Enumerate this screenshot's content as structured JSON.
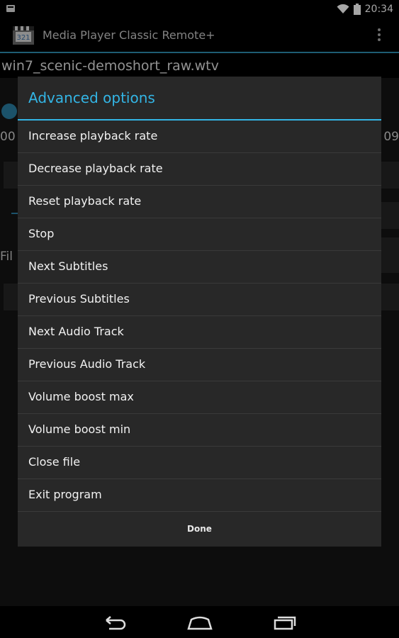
{
  "status_bar": {
    "time": "20:34"
  },
  "action_bar": {
    "title": "Media Player Classic Remote+",
    "icon_text": "321"
  },
  "background": {
    "filename": "win7_scenic-demoshort_raw.wtv",
    "time_left": "00",
    "time_right": "09",
    "label_partial": "Fil"
  },
  "dialog": {
    "title": "Advanced options",
    "items": [
      "Increase playback rate",
      "Decrease playback rate",
      "Reset playback rate",
      "Stop",
      "Next Subtitles",
      "Previous Subtitles",
      "Next Audio Track",
      "Previous Audio Track",
      "Volume boost max",
      "Volume boost min",
      "Close file",
      "Exit program"
    ],
    "done_label": "Done"
  },
  "colors": {
    "accent": "#33b5e5",
    "dialog_bg": "#282828",
    "action_divider": "#2f8fb1"
  },
  "icons": [
    "notification-icon",
    "wifi-icon",
    "battery-icon",
    "app-icon",
    "overflow-menu-icon",
    "back-icon",
    "home-icon",
    "recents-icon"
  ]
}
